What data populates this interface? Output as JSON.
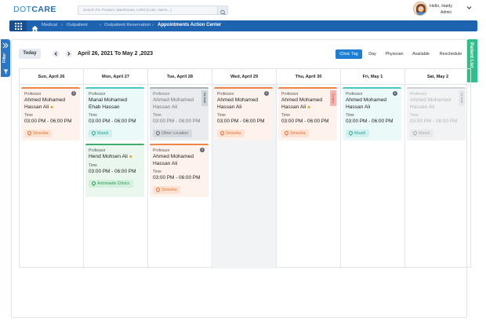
{
  "header": {
    "logo_part1": "DOT",
    "logo_part2": "CARE",
    "search_placeholder": "Search For Product, Warehouse, UOM (Code, Name...)",
    "greeting": "Hello, Haidy",
    "role": "Admin"
  },
  "breadcrumb": {
    "items": [
      "Medical",
      "Outpatient",
      "Outpatient Reservation",
      "Appointments Action Center"
    ]
  },
  "side_tabs": {
    "filter": "Filter",
    "patient_list": "Patient List"
  },
  "toolbar": {
    "today": "Today",
    "prev": "‹",
    "next": "›",
    "date_range": "April 26, 2021 To May 2 ,2023",
    "views": [
      "Clinic Tag",
      "Day",
      "Physician",
      "Available",
      "Reschedule"
    ],
    "active_view": "Clinic Tag"
  },
  "calendar": {
    "days": [
      "Sun, April 26",
      "Mon, April 27",
      "Tue, April 28",
      "Wed, April 29",
      "Thu, April 30",
      "Fri, May 1",
      "Sat, May 2"
    ],
    "time_label": "Time",
    "appointments": [
      {
        "title": "Professor",
        "name1": "Ahmed Mohamed",
        "name2": "Hassan Ali",
        "time": "03:00 PM - 06:00 PM",
        "location": "Smouha"
      },
      {
        "title": "Professor",
        "name1": "Manal Mohamed",
        "name2": "Ehab Hassan",
        "time": "03:00 PM - 06:00 PM",
        "location": "Maadi"
      },
      {
        "title": "Professor",
        "name1": "Hend Mohsen Ali",
        "name2": "",
        "time": "03:00 PM - 06:00 PM",
        "location": "Antoniadis Clinics"
      },
      {
        "title": "Professor",
        "name1": "Ahmed Mohamed",
        "name2": "Hassan Ali",
        "time": "03:00 PM - 06:00 PM",
        "location": "Other Location",
        "badge": "On Hold"
      },
      {
        "title": "Professor",
        "name1": "Ahmed Mohamed",
        "name2": "Hassan Ali",
        "time": "03:00 PM - 06:00 PM",
        "location": "Smouha"
      },
      {
        "title": "Professor",
        "name1": "Ahmed Mohamed",
        "name2": "Hassan Ali",
        "time": "03:00 PM - 06:00 PM",
        "location": "Smouha"
      },
      {
        "title": "Professor",
        "name1": "Ahmed Mohamed",
        "name2": "Hassan Ali",
        "time": "03:00 PM - 06:00 PM",
        "location": "Smouha",
        "badge": "Surgery"
      },
      {
        "title": "Professor",
        "name1": "Ahmed Mohamed",
        "name2": "Hassan Ali",
        "time": "03:00 PM - 06:00 PM",
        "location": "Maadi"
      },
      {
        "title": "Professor",
        "name1": "Ahmed Mohamed",
        "name2": "Hassan Ali",
        "time": "03:00 PM - 06:00 PM",
        "location": "Maadi",
        "badge": "On Hold"
      }
    ]
  },
  "colors": {
    "brand_blue": "#1d63b0",
    "active_tab": "#1d7fd4",
    "patient_tab": "#2fbf8a",
    "orange": "#f0854a",
    "teal": "#4ac7c0",
    "green": "#3fae6d",
    "grey": "#a9afb7"
  }
}
